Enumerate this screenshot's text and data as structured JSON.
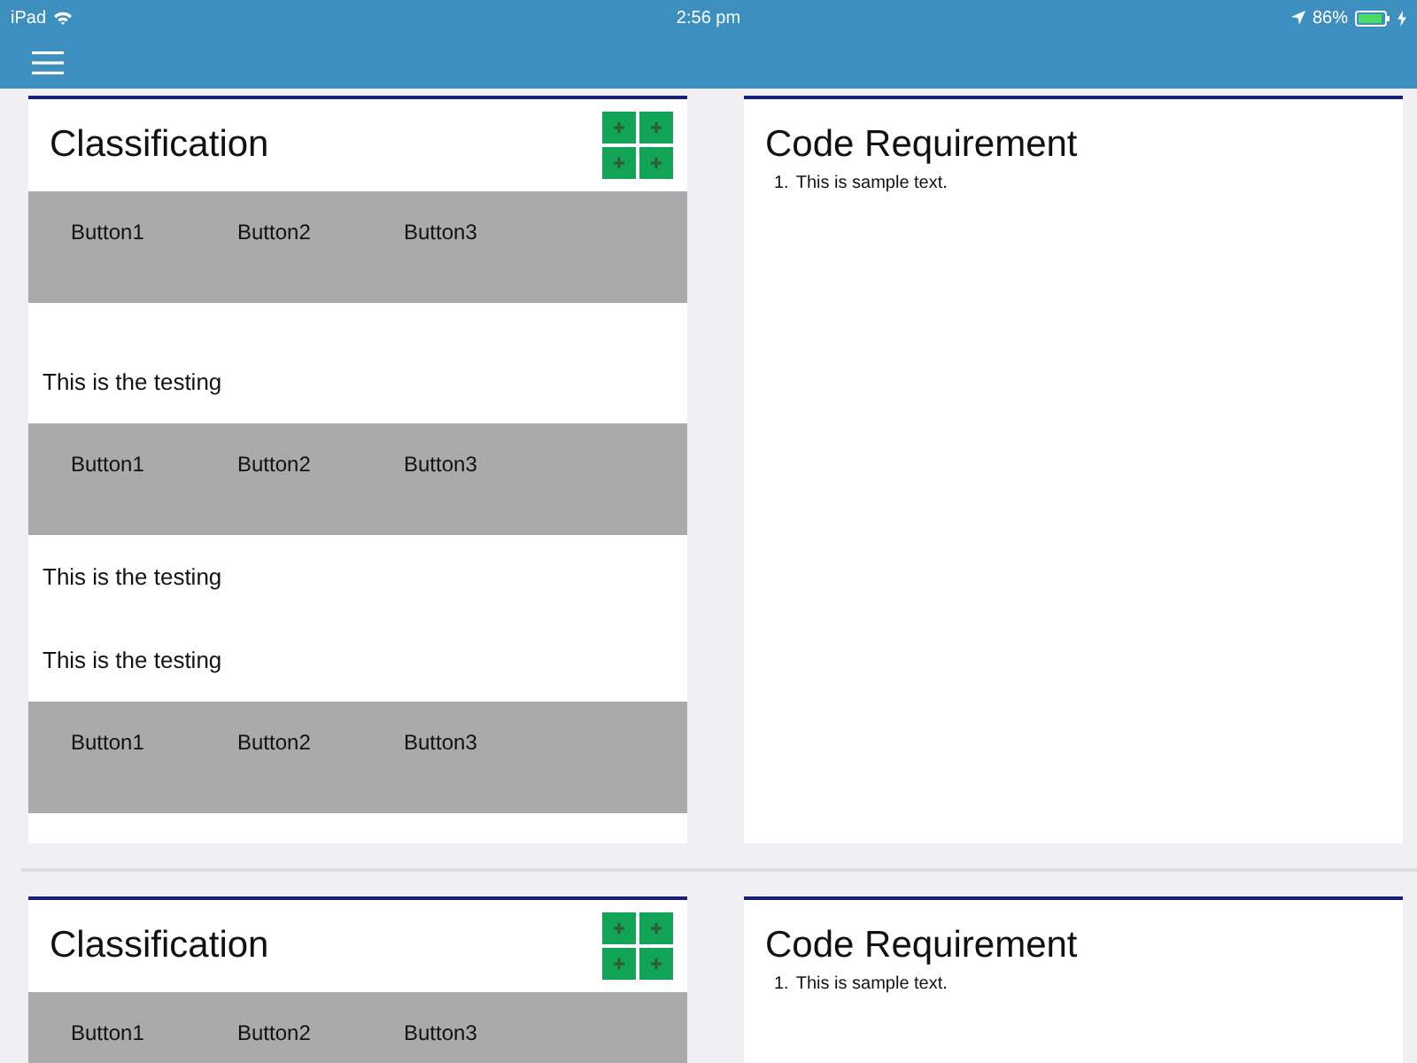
{
  "status_bar": {
    "carrier": "iPad",
    "time": "2:56 pm",
    "battery": "86%"
  },
  "sections": [
    {
      "classification": {
        "title": "Classification",
        "items": [
          {
            "kind": "buttons",
            "buttons": [
              "Button1",
              "Button2",
              "Button3"
            ]
          },
          {
            "kind": "text",
            "text": "This is the testing"
          },
          {
            "kind": "buttons",
            "buttons": [
              "Button1",
              "Button2",
              "Button3"
            ]
          },
          {
            "kind": "text",
            "text": "This is the testing"
          },
          {
            "kind": "text",
            "text": "This is the testing"
          },
          {
            "kind": "buttons",
            "buttons": [
              "Button1",
              "Button2",
              "Button3"
            ]
          }
        ]
      },
      "requirement": {
        "title": "Code Requirement",
        "items": [
          {
            "number": "1.",
            "text": "This is sample text."
          }
        ]
      }
    },
    {
      "classification": {
        "title": "Classification",
        "items": [
          {
            "kind": "buttons",
            "buttons": [
              "Button1",
              "Button2",
              "Button3"
            ]
          }
        ]
      },
      "requirement": {
        "title": "Code Requirement",
        "items": [
          {
            "number": "1.",
            "text": "This is sample text."
          }
        ]
      }
    }
  ]
}
